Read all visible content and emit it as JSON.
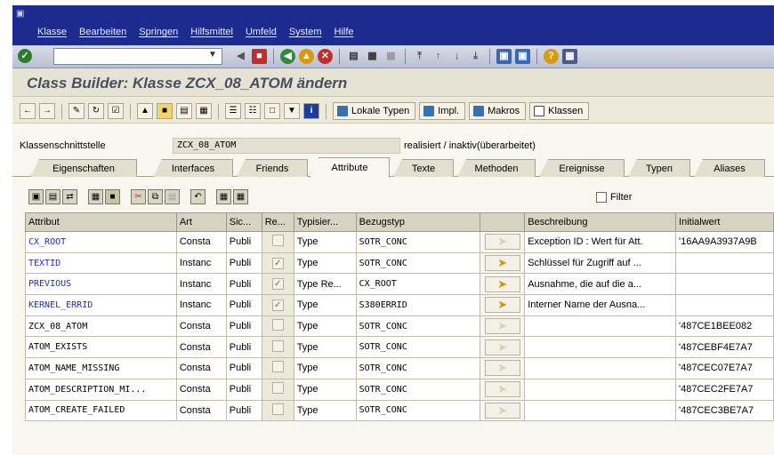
{
  "menu": {
    "items": [
      "Klasse",
      "Bearbeiten",
      "Springen",
      "Hilfsmittel",
      "Umfeld",
      "System",
      "Hilfe"
    ]
  },
  "system_toolbar": {
    "command_field_value": ""
  },
  "title": "Class Builder: Klasse ZCX_08_ATOM ändern",
  "app_toolbar": {
    "lokale_typen": "Lokale Typen",
    "impl": "Impl.",
    "makros": "Makros",
    "klassen": "Klassen"
  },
  "header": {
    "label": "Klassenschnittstelle",
    "value": "ZCX_08_ATOM",
    "status": "realisiert / inaktiv(überarbeitet)"
  },
  "tabs": [
    "Eigenschaften",
    "Interfaces",
    "Friends",
    "Attribute",
    "Texte",
    "Methoden",
    "Ereignisse",
    "Typen",
    "Aliases"
  ],
  "active_tab": "Attribute",
  "filter_label": "Filter",
  "table": {
    "columns": [
      "Attribut",
      "Art",
      "Sic...",
      "Re...",
      "Typisier...",
      "Bezugstyp",
      "",
      "Beschreibung",
      "Initialwert"
    ],
    "rows": [
      {
        "attr": "CX_ROOT",
        "art": "Consta",
        "sic": "Publi",
        "re": "",
        "typ": "Type",
        "bez": "SOTR_CONC",
        "desc": "Exception ID : Wert für Att.",
        "init": "'16AA9A3937A9B"
      },
      {
        "attr": "TEXTID",
        "art": "Instanc",
        "sic": "Publi",
        "re": "✓",
        "typ": "Type",
        "bez": "SOTR_CONC",
        "desc": "Schlüssel für Zugriff auf ...",
        "init": ""
      },
      {
        "attr": "PREVIOUS",
        "art": "Instanc",
        "sic": "Publi",
        "re": "✓",
        "typ": "Type Re...",
        "bez": "CX_ROOT",
        "desc": "Ausnahme, die auf die a...",
        "init": ""
      },
      {
        "attr": "KERNEL_ERRID",
        "art": "Instanc",
        "sic": "Publi",
        "re": "✓",
        "typ": "Type",
        "bez": "S380ERRID",
        "desc": "Interner Name der Ausna...",
        "init": ""
      },
      {
        "attr": "ZCX_08_ATOM",
        "art": "Consta",
        "sic": "Publi",
        "re": "",
        "typ": "Type",
        "bez": "SOTR_CONC",
        "desc": "",
        "init": "'487CE1BEE082"
      },
      {
        "attr": "ATOM_EXISTS",
        "art": "Consta",
        "sic": "Publi",
        "re": "",
        "typ": "Type",
        "bez": "SOTR_CONC",
        "desc": "",
        "init": "'487CEBF4E7A7"
      },
      {
        "attr": "ATOM_NAME_MISSING",
        "art": "Consta",
        "sic": "Publi",
        "re": "",
        "typ": "Type",
        "bez": "SOTR_CONC",
        "desc": "",
        "init": "'487CEC07E7A7"
      },
      {
        "attr": "ATOM_DESCRIPTION_MI...",
        "art": "Consta",
        "sic": "Publi",
        "re": "",
        "typ": "Type",
        "bez": "SOTR_CONC",
        "desc": "",
        "init": "'487CEC2FE7A7"
      },
      {
        "attr": "ATOM_CREATE_FAILED",
        "art": "Consta",
        "sic": "Publi",
        "re": "",
        "typ": "Type",
        "bez": "SOTR_CONC",
        "desc": "",
        "init": "'487CEC3BE7A7"
      }
    ],
    "blue_rows": [
      0,
      1,
      2,
      3
    ],
    "active_arrow_rows": [
      1,
      2,
      3
    ]
  }
}
